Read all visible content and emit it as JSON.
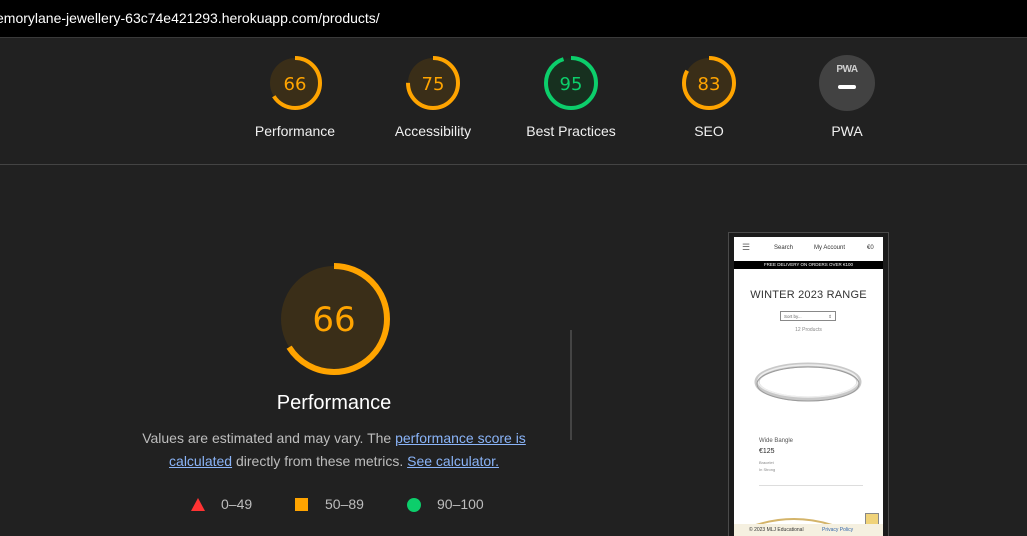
{
  "address_bar": {
    "url": "emorylane-jewellery-63c74e421293.herokuapp.com/products/"
  },
  "colors": {
    "average": "#ffa400",
    "pass": "#0cce6b",
    "fail": "#ff3333",
    "link": "#8ab4f8"
  },
  "categories": [
    {
      "label": "Performance",
      "score": "66",
      "value": 66,
      "color": "#ffa400"
    },
    {
      "label": "Accessibility",
      "score": "75",
      "value": 75,
      "color": "#ffa400"
    },
    {
      "label": "Best Practices",
      "score": "95",
      "value": 95,
      "color": "#0cce6b"
    },
    {
      "label": "SEO",
      "score": "83",
      "value": 83,
      "color": "#ffa400"
    },
    {
      "label": "PWA",
      "badge": "PWA"
    }
  ],
  "performance": {
    "score": "66",
    "value": 66,
    "title": "Performance",
    "desc_prefix": "Values are estimated and may vary. The ",
    "desc_link1": "performance score is calculated",
    "desc_middle": " directly from these metrics. ",
    "desc_link2": "See calculator."
  },
  "legend": [
    {
      "shape": "triangle-icon",
      "range": "0–49"
    },
    {
      "shape": "square-icon",
      "range": "50–89"
    },
    {
      "shape": "circle-icon",
      "range": "90–100"
    }
  ],
  "screenshot": {
    "nav_menu": "☰",
    "nav_search": "Search",
    "nav_account": "My Account",
    "nav_cart": "€0",
    "banner": "FREE DELIVERY ON ORDERS OVER €100",
    "heading": "WINTER 2023 RANGE",
    "sort": "Sort by...",
    "sort_arrow": "⇕",
    "count": "12 Products",
    "product_name": "Wide Bangle",
    "product_price": "€125",
    "product_category": "Bracelet",
    "product_tag": "In Strong",
    "footer_copy": "© 2023 MLJ Educational",
    "footer_privacy": "Privacy Policy"
  }
}
